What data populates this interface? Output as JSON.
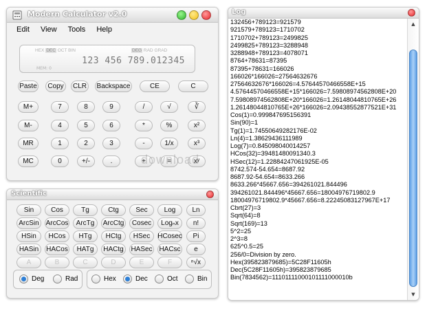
{
  "calculator": {
    "title": "Modern Calculator v2.0",
    "menu": [
      "Edit",
      "View",
      "Tools",
      "Help"
    ],
    "display": {
      "mode_left": [
        "HEX",
        "DEC",
        "OCT",
        "BIN"
      ],
      "mode_left_active": "DEC",
      "mode_right": [
        "DEG",
        "RAD",
        "GRAD"
      ],
      "mode_right_active": "DEG",
      "memory": "MEM: 0",
      "value": "123 456 789.012345"
    },
    "rows": [
      [
        "Paste",
        "Copy",
        "CLR",
        "Backspace",
        "CE",
        "C"
      ],
      [
        "M+",
        "7",
        "8",
        "9",
        "/",
        "√",
        "∛"
      ],
      [
        "M-",
        "4",
        "5",
        "6",
        "*",
        "%",
        "x²"
      ],
      [
        "MR",
        "1",
        "2",
        "3",
        "-",
        "1/x",
        "x³"
      ],
      [
        "MC",
        "0",
        "+/-",
        ".",
        "+",
        "=",
        "xʸ"
      ]
    ]
  },
  "scientific": {
    "title": "Scientific",
    "rows": [
      [
        "Sin",
        "Cos",
        "Tg",
        "Ctg",
        "Sec",
        "Log",
        "Ln"
      ],
      [
        "ArcSin",
        "ArcCos",
        "ArcTg",
        "ArcCtg",
        "Cosec",
        "Logₙx",
        "n!"
      ],
      [
        "HSin",
        "HCos",
        "HTg",
        "HCtg",
        "HSec",
        "HCosec",
        "Pi"
      ],
      [
        "HASin",
        "HACos",
        "HATg",
        "HACtg",
        "HASec",
        "HACsc",
        "e"
      ],
      [
        "A",
        "B",
        "C",
        "D",
        "E",
        "F",
        "ⁿ√x"
      ]
    ],
    "angle_units": [
      {
        "label": "Deg",
        "checked": true
      },
      {
        "label": "Rad",
        "checked": false
      }
    ],
    "number_bases": [
      {
        "label": "Hex",
        "checked": false
      },
      {
        "label": "Dec",
        "checked": true
      },
      {
        "label": "Oct",
        "checked": false
      },
      {
        "label": "Bin",
        "checked": false
      }
    ]
  },
  "log": {
    "title": "Log",
    "lines": [
      "132456+789123=921579",
      "921579+789123=1710702",
      "1710702+789123=2499825",
      "2499825+789123=3288948",
      "3288948+789123=4078071",
      "8764+78631=87395",
      "87395+78631=166026",
      "166026*166026=27564632676",
      "27564632676*166026=4.57644570466558E+15",
      "4.57644570466558E+15*166026=7.59808974562808E+20",
      "7.59808974562808E+20*166026=1.26148044810765E+26",
      "1.26148044810765E+26*166026=2.09438552877521E+31",
      "Cos(1)=0.999847695156391",
      "Sin(90)=1",
      "Tg(1)=1.74550649282176E-02",
      "Ln(4)=1.38629436111989",
      "Log(7)=0.845098040014257",
      "HCos(32)=39481480091340.3",
      "HSec(12)=1.22884247061925E-05",
      "8742.574-54.654=8687.92",
      "8687.92-54.654=8633.266",
      "8633.266*45667.656=394261021.844496",
      "394261021.844496*45667.656=18004976719802.9",
      "18004976719802.9*45667.656=8.22245083127967E+17",
      "Cbrt(27)=3",
      "Sqrt(64)=8",
      "Sqrt(169)=13",
      "5^2=25",
      "2^3=8",
      "625^0.5=25",
      "256/0=Division by zero.",
      "Hex(395823879685)=5C28F11605h",
      "Dec(5C28F11605h)=395823879685",
      "Bin(7834562)=11101111000101111000010b"
    ]
  },
  "watermark": "download",
  "colors": {
    "close": "#e8262a",
    "minimize": "#f3c21a",
    "maximize": "#2fb52c",
    "accent": "#2d7fd6"
  }
}
